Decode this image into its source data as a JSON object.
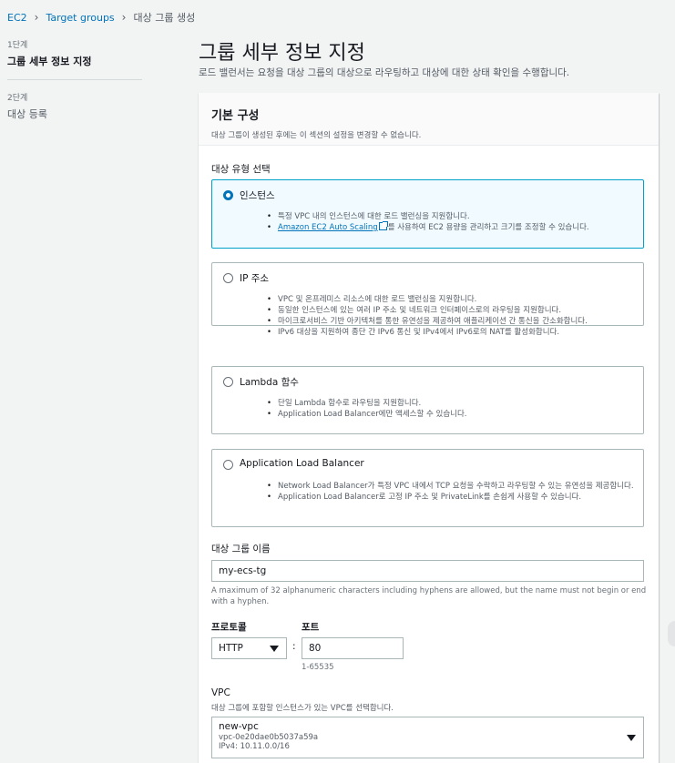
{
  "breadcrumb": [
    "EC2",
    "Target groups",
    "대상 그룹 생성"
  ],
  "steps": [
    {
      "num": "1단계",
      "title": "그룹 세부 정보 지정"
    },
    {
      "num": "2단계",
      "title": "대상 등록"
    }
  ],
  "page": {
    "title": "그룹 세부 정보 지정",
    "subtitle": "로드 밸런서는 요청을 대상 그룹의 대상으로 라우팅하고 대상에 대한 상태 확인을 수행합니다."
  },
  "basic": {
    "title": "기본 구성",
    "desc": "대상 그룹이 생성된 후에는 이 섹션의 설정을 변경할 수 없습니다.",
    "target_type_label": "대상 유형 선택"
  },
  "target_types": [
    {
      "title": "인스턴스",
      "selected": true,
      "b1": "특정 VPC 내의 인스턴스에 대한 로드 밸런싱을 지원합니다.",
      "b2_link": "Amazon EC2 Auto Scaling",
      "b2_rest": "를 사용하여 EC2 용량을 관리하고 크기를 조정할 수 있습니다."
    },
    {
      "title": "IP 주소",
      "selected": false,
      "bullets": [
        "VPC 및 온프레미스 리소스에 대한 로드 밸런싱을 지원합니다.",
        "동일한 인스턴스에 있는 여러 IP 주소 및 네트워크 인터페이스로의 라우팅을 지원합니다.",
        "마이크로서비스 기반 아키텍처를 통한 유연성을 제공하여 애플리케이션 간 통신을 간소화합니다.",
        "IPv6 대상을 지원하여 종단 간 IPv6 통신 및 IPv4에서 IPv6로의 NAT를 활성화합니다."
      ]
    },
    {
      "title": "Lambda 함수",
      "selected": false,
      "bullets": [
        "단일 Lambda 함수로 라우팅을 지원합니다.",
        "Application Load Balancer에만 액세스할 수 있습니다."
      ]
    },
    {
      "title": "Application Load Balancer",
      "selected": false,
      "bullets": [
        "Network Load Balancer가 특정 VPC 내에서 TCP 요청을 수락하고 라우팅할 수 있는 유연성을 제공합니다.",
        "Application Load Balancer로 고정 IP 주소 및 PrivateLink를 손쉽게 사용할 수 있습니다."
      ]
    }
  ],
  "name_field": {
    "label": "대상 그룹 이름",
    "value": "my-ecs-tg",
    "hint": "A maximum of 32 alphanumeric characters including hyphens are allowed, but the name must not begin or end with a hyphen."
  },
  "protocol": {
    "label": "프로토콜",
    "value": "HTTP"
  },
  "port": {
    "label": "포트",
    "value": "80",
    "hint": "1-65535",
    "colon": ":"
  },
  "vpc": {
    "label": "VPC",
    "desc": "대상 그룹에 포함할 인스턴스가 있는 VPC를 선택합니다.",
    "name": "new-vpc",
    "id": "vpc-0e20dae0b5037a59a",
    "cidr": "IPv4: 10.11.0.0/16"
  }
}
